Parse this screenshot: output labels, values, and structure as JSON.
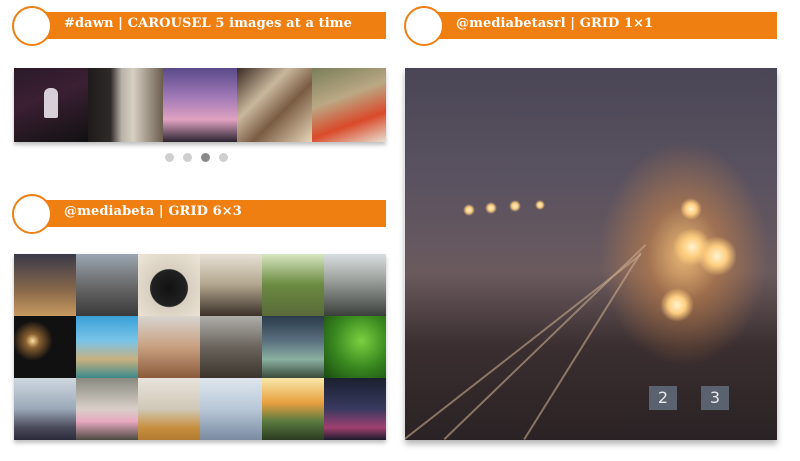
{
  "carousel": {
    "title": "#dawn | CAROUSEL 5 images at a time",
    "page_count": 4,
    "active_page": 3
  },
  "grid6": {
    "title": "@mediabeta | GRID 6×3"
  },
  "grid1": {
    "title": "@mediabetasrl | GRID 1×1",
    "platform_signs": [
      "2",
      "3"
    ]
  },
  "colors": {
    "accent": "#f07f12",
    "dot_inactive": "#cfcfcf",
    "dot_active": "#8a8a8a"
  }
}
